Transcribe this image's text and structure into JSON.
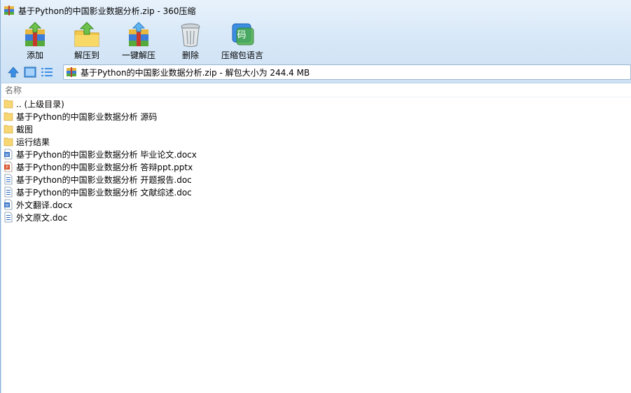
{
  "window": {
    "title": "基于Python的中国影业数据分析.zip - 360压缩"
  },
  "toolbar": {
    "add_label": "添加",
    "extract_to_label": "解压到",
    "one_click_extract_label": "一键解压",
    "delete_label": "删除",
    "archive_language_label": "压缩包语言",
    "language_icon_glyph": "码"
  },
  "addressbar": {
    "path_text": "基于Python的中国影业数据分析.zip - 解包大小为 244.4 MB"
  },
  "filelist": {
    "column_name": "名称",
    "items": [
      {
        "label": ".. (上级目录)",
        "icon": "folder-up-icon"
      },
      {
        "label": "基于Python的中国影业数据分析 源码",
        "icon": "folder-icon"
      },
      {
        "label": "截图",
        "icon": "folder-icon"
      },
      {
        "label": "运行结果",
        "icon": "folder-icon"
      },
      {
        "label": "基于Python的中国影业数据分析 毕业论文.docx",
        "icon": "word-docx-icon"
      },
      {
        "label": "基于Python的中国影业数据分析 答辩ppt.pptx",
        "icon": "powerpoint-icon"
      },
      {
        "label": "基于Python的中国影业数据分析 开题报告.doc",
        "icon": "word-doc-icon"
      },
      {
        "label": "基于Python的中国影业数据分析 文献综述.doc",
        "icon": "word-doc-icon"
      },
      {
        "label": "外文翻译.docx",
        "icon": "word-docx-icon"
      },
      {
        "label": "外文原文.doc",
        "icon": "word-doc-icon"
      }
    ]
  },
  "colors": {
    "folder": "#f7d774",
    "word": "#2b6cc4",
    "powerpoint": "#d9532b",
    "accent": "#3a8ee6"
  }
}
